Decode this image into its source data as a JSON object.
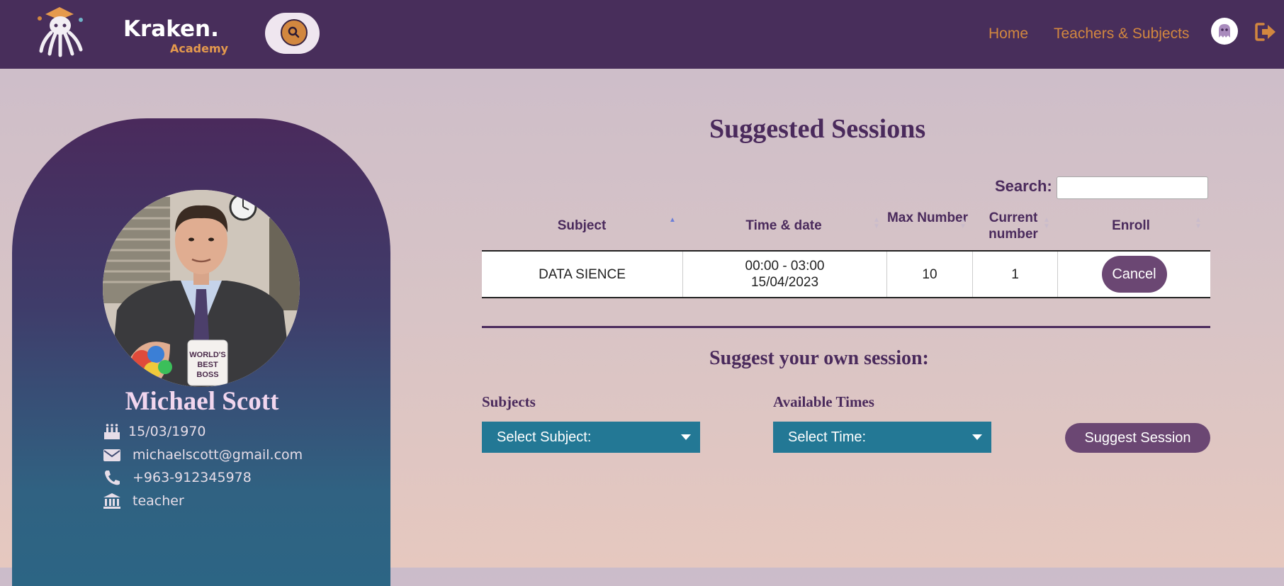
{
  "nav": {
    "logo_text": "Kraken.",
    "logo_sub": "Academy",
    "links": [
      "Home",
      "Teachers & Subjects"
    ],
    "search_icon": "search-icon",
    "profile_icon": "ghost-avatar-icon",
    "logout_icon": "logout-icon"
  },
  "profile": {
    "name": "Michael Scott",
    "birthdate": "15/03/1970",
    "email": "michaelscott@gmail.com",
    "phone": "+963-912345978",
    "role": "teacher",
    "mug_text": [
      "WORLD'S",
      "BEST",
      "BOSS"
    ]
  },
  "sessions": {
    "title": "Suggested Sessions",
    "search_label": "Search:",
    "search_value": "",
    "columns": [
      "Subject",
      "Time & date",
      "Max Number",
      "Current number",
      "Enroll"
    ],
    "rows": [
      {
        "subject": "DATA SIENCE",
        "time": "00:00 - 03:00",
        "date": "15/04/2023",
        "max": "10",
        "current": "1",
        "action": "Cancel"
      }
    ]
  },
  "suggest": {
    "title": "Suggest your own session:",
    "subjects_label": "Subjects",
    "subjects_selected": "Select Subject:",
    "times_label": "Available Times",
    "times_selected": "Select Time:",
    "button": "Suggest Session"
  },
  "colors": {
    "navbar": "#482e5b",
    "accent_orange": "#d2873f",
    "purple_button": "#6b4773",
    "select_teal": "#237895",
    "heading_purple": "#4a2a5c"
  }
}
